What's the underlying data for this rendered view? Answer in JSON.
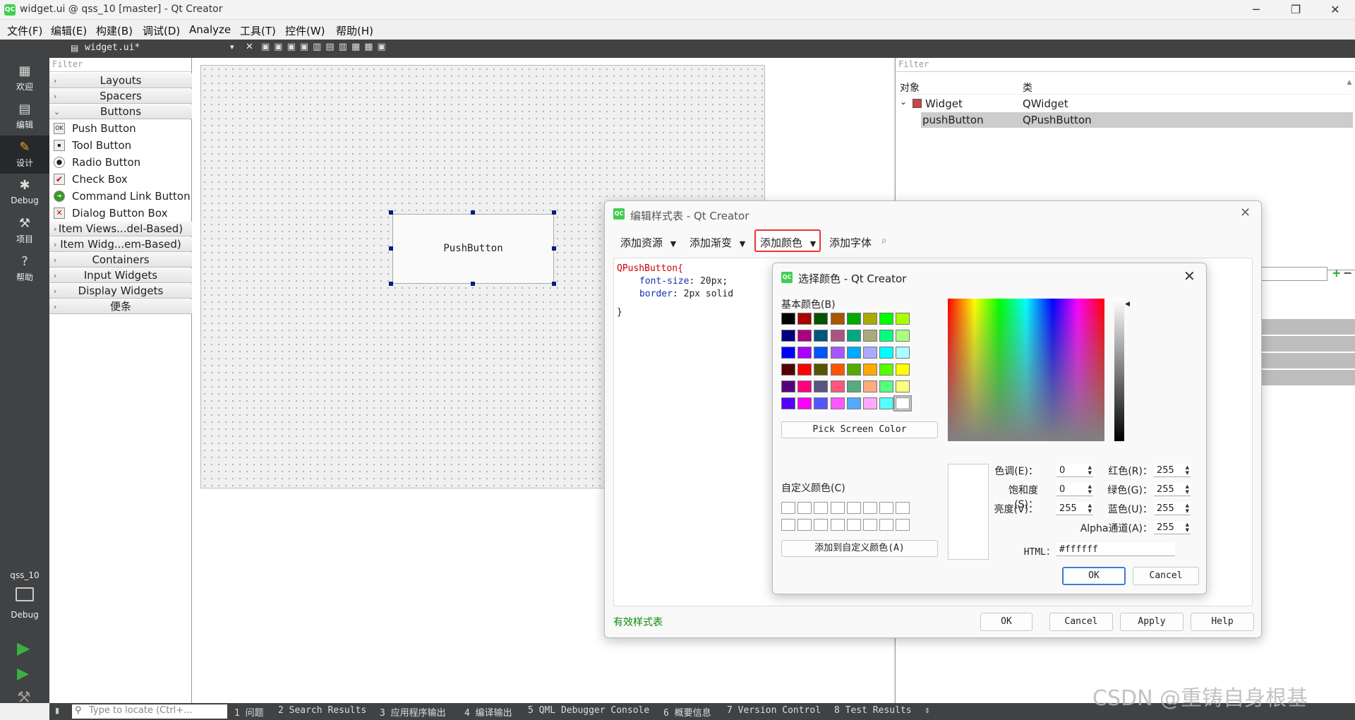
{
  "window": {
    "title": "widget.ui @ qss_10 [master] - Qt Creator",
    "app_icon": "QC",
    "controls": [
      "─",
      "❐",
      "✕"
    ]
  },
  "menu": [
    "文件(F)",
    "编辑(E)",
    "构建(B)",
    "调试(D)",
    "Analyze",
    "工具(T)",
    "控件(W)",
    "帮助(H)"
  ],
  "modes": [
    {
      "label": "欢迎",
      "icon": "grid-icon"
    },
    {
      "label": "编辑",
      "icon": "document-icon"
    },
    {
      "label": "设计",
      "icon": "pencil-icon"
    },
    {
      "label": "Debug",
      "icon": "bug-icon"
    },
    {
      "label": "项目",
      "icon": "wrench-icon"
    },
    {
      "label": "帮助",
      "icon": "help-icon"
    }
  ],
  "kit": {
    "project": "qss_10",
    "build": "Debug"
  },
  "editor_tab": {
    "file": "widget.ui*"
  },
  "widgetbox": {
    "filter_placeholder": "Filter",
    "categories_top": [
      "Layouts",
      "Spacers",
      "Buttons"
    ],
    "buttons": [
      "Push Button",
      "Tool Button",
      "Radio Button",
      "Check Box",
      "Command Link Button",
      "Dialog Button Box"
    ],
    "categories_bottom": [
      "Item Views...del-Based)",
      "Item Widg...em-Based)",
      "Containers",
      "Input Widgets",
      "Display Widgets",
      "便条"
    ]
  },
  "form": {
    "button_text": "PushButton"
  },
  "object_inspector": {
    "filter_placeholder": "Filter",
    "col_object": "对象",
    "col_class": "类",
    "rows": [
      {
        "object": "Widget",
        "class": "QWidget"
      },
      {
        "object": "pushButton",
        "class": "QPushButton"
      }
    ]
  },
  "stylesheet_dialog": {
    "title": "编辑样式表 - Qt Creator",
    "toolbar": [
      "添加资源",
      "添加渐变",
      "添加颜色",
      "添加字体"
    ],
    "code": {
      "line1": "QPushButton{",
      "prop1": "font-size",
      "val1": ": 20px;",
      "prop2": "border",
      "val2": ": 2px solid",
      "line_end": "}"
    },
    "valid_text": "有效样式表",
    "buttons": [
      "OK",
      "Cancel",
      "Apply",
      "Help"
    ]
  },
  "color_dialog": {
    "title": "选择颜色 - Qt Creator",
    "basic_label": "基本颜色(B)",
    "basic_colors": [
      "#000000",
      "#aa0000",
      "#005500",
      "#aa5500",
      "#00aa00",
      "#aaaa00",
      "#00ff00",
      "#aaff00",
      "#00007f",
      "#aa007f",
      "#00557f",
      "#aa557f",
      "#00aa7f",
      "#aaaa7f",
      "#00ff7f",
      "#aaff7f",
      "#0000ff",
      "#aa00ff",
      "#0055ff",
      "#aa55ff",
      "#00aaff",
      "#aaaaff",
      "#00ffff",
      "#aaffff",
      "#550000",
      "#ff0000",
      "#555500",
      "#ff5500",
      "#55aa00",
      "#ffaa00",
      "#55ff00",
      "#ffff00",
      "#55007f",
      "#ff007f",
      "#55557f",
      "#ff557f",
      "#55aa7f",
      "#ffaa7f",
      "#55ff7f",
      "#ffff7f",
      "#5500ff",
      "#ff00ff",
      "#5555ff",
      "#ff55ff",
      "#55aaff",
      "#ffaaff",
      "#55ffff",
      "#ffffff"
    ],
    "pick_screen": "Pick Screen Color",
    "custom_label": "自定义颜色(C)",
    "add_custom": "添加到自定义颜色(A)",
    "fields": {
      "hue_label": "色调(E)：",
      "hue": "0",
      "sat_label": "饱和度(S)：",
      "sat": "0",
      "val_label": "亮度(V)：",
      "val": "255",
      "red_label": "红色(R)：",
      "red": "255",
      "green_label": "绿色(G)：",
      "green": "255",
      "blue_label": "蓝色(U)：",
      "blue": "255",
      "alpha_label": "Alpha通道(A)：",
      "alpha": "255",
      "html_label": "HTML：",
      "html": "#ffffff"
    },
    "ok": "OK",
    "cancel": "Cancel"
  },
  "statusbar": {
    "locate_placeholder": "Type to locate (Ctrl+...",
    "panes": [
      "1 问题",
      "2 Search Results",
      "3 应用程序输出",
      "4 编译输出",
      "5 QML Debugger Console",
      "6 概要信息",
      "7 Version Control",
      "8 Test Results"
    ]
  },
  "watermark": "CSDN @重铸自身根基"
}
